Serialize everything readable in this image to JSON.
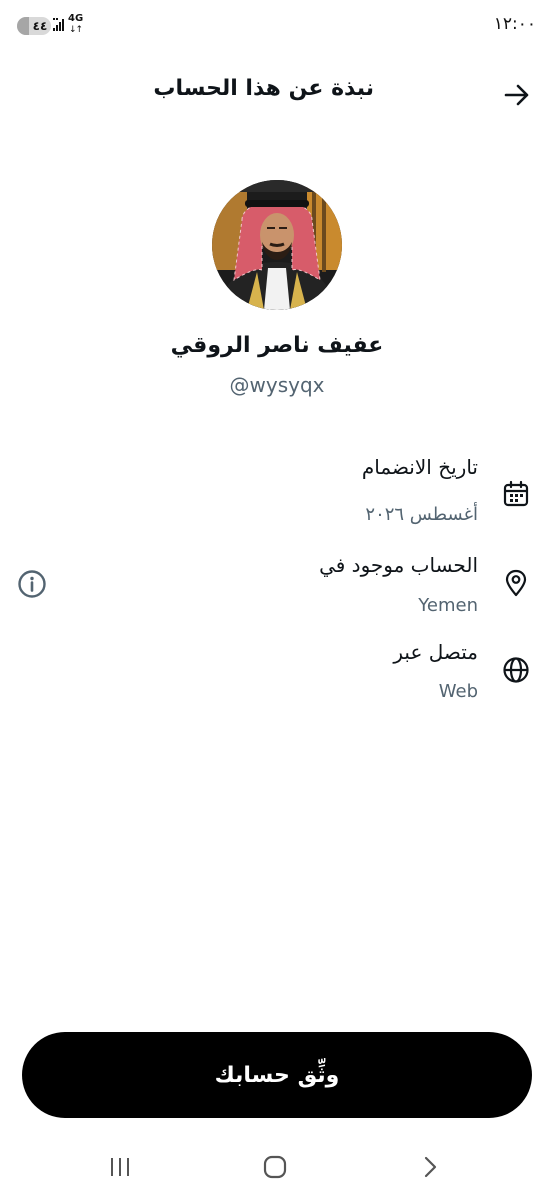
{
  "status_bar": {
    "time": "١٢:٠٠",
    "battery_level": "٤٤",
    "network": "4G",
    "network_arrows": "↓↑"
  },
  "header": {
    "title": "نبذة عن هذا الحساب",
    "back_icon": "arrow-right-icon"
  },
  "profile": {
    "display_name": "عفيف ناصر الروقي",
    "handle": "@wysyqx"
  },
  "about_rows": [
    {
      "title": "تاريخ الانضمام",
      "value": "أغسطس ٢٠٢٦",
      "icon": "calendar-icon"
    },
    {
      "title": "الحساب موجود في",
      "value": "Yemen",
      "icon": "location-pin-icon"
    },
    {
      "title": "متصل عبر",
      "value": "Web",
      "icon": "globe-icon"
    }
  ],
  "info_icon": "info-icon",
  "verify_button": {
    "label": "وثِّق حسابك"
  },
  "navbar": {
    "recents_icon": "recents-icon",
    "home_icon": "home-icon",
    "back_icon": "back-chevron-icon"
  },
  "colors": {
    "primary_text": "#0f1419",
    "secondary_text": "#536471",
    "button_bg": "#000000",
    "button_text": "#ffffff"
  }
}
